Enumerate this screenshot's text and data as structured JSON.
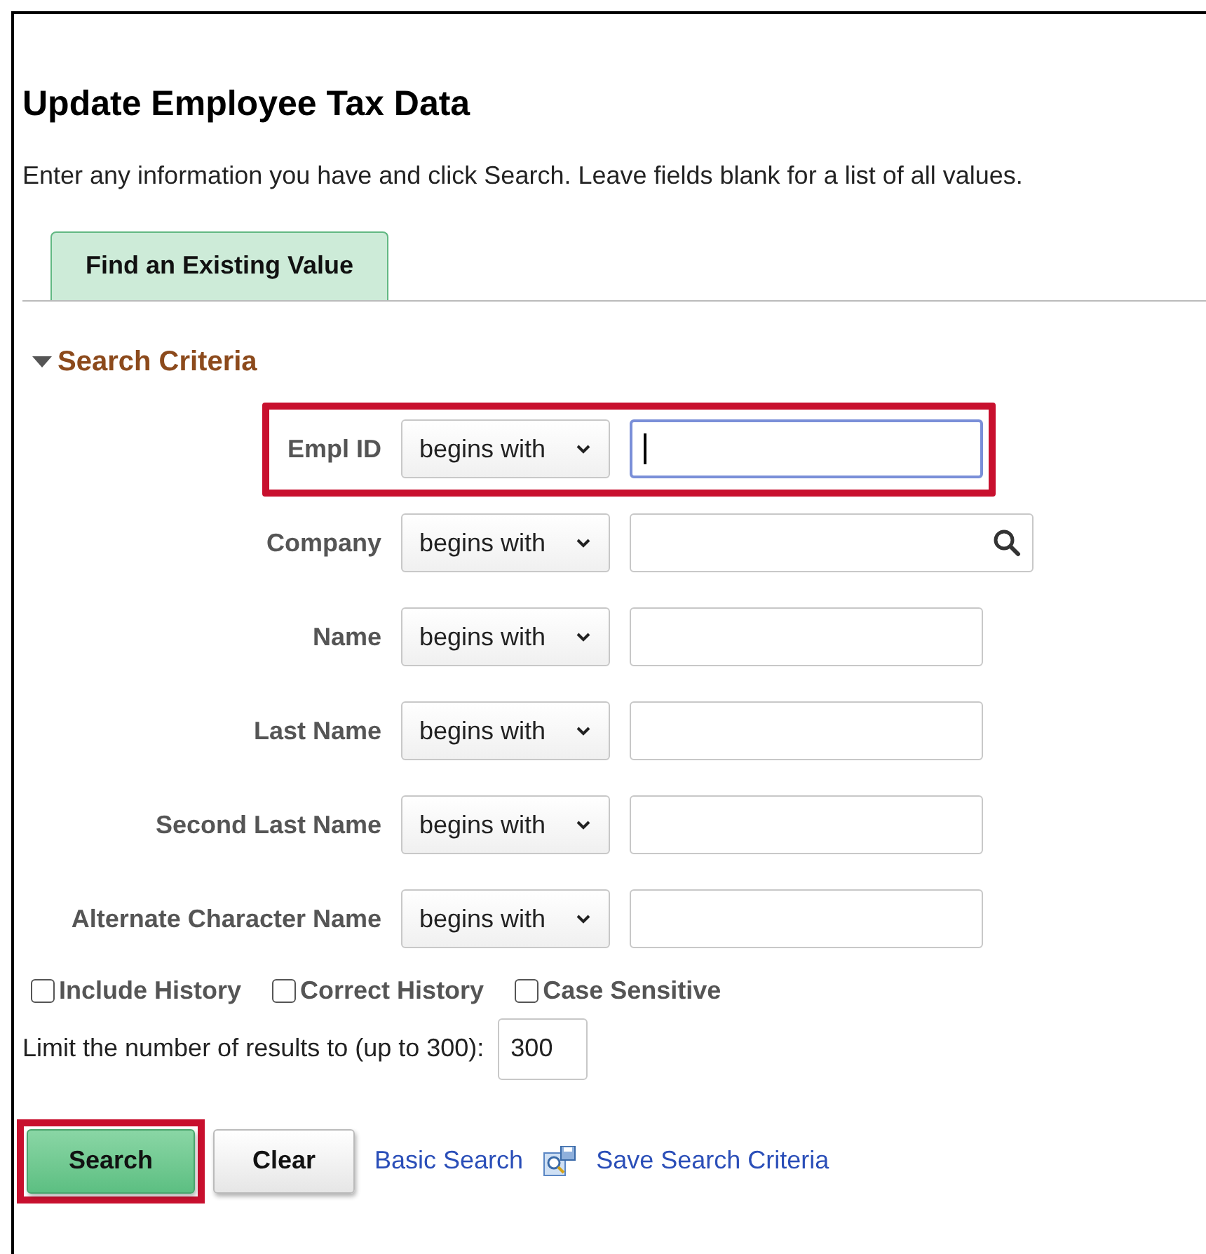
{
  "title": "Update Employee Tax Data",
  "instructions": "Enter any information you have and click Search. Leave fields blank for a list of all values.",
  "tabs": [
    {
      "label": "Find an Existing Value",
      "selected": true
    }
  ],
  "section": {
    "title": "Search Criteria",
    "expanded": true
  },
  "fields": [
    {
      "label": "Empl ID",
      "operator": "begins with",
      "kind": "text",
      "focused": true,
      "highlighted": true
    },
    {
      "label": "Company",
      "operator": "begins with",
      "kind": "lookup",
      "focused": false,
      "highlighted": false
    },
    {
      "label": "Name",
      "operator": "begins with",
      "kind": "text",
      "focused": false,
      "highlighted": false
    },
    {
      "label": "Last Name",
      "operator": "begins with",
      "kind": "text",
      "focused": false,
      "highlighted": false
    },
    {
      "label": "Second Last Name",
      "operator": "begins with",
      "kind": "text",
      "focused": false,
      "highlighted": false
    },
    {
      "label": "Alternate Character Name",
      "operator": "begins with",
      "kind": "text",
      "focused": false,
      "highlighted": false
    }
  ],
  "checkboxes": [
    {
      "label": "Include History",
      "checked": false
    },
    {
      "label": "Correct History",
      "checked": false
    },
    {
      "label": "Case Sensitive",
      "checked": false
    }
  ],
  "limit": {
    "label": "Limit the number of results to (up to 300):",
    "value": "300"
  },
  "buttons": [
    {
      "label": "Search",
      "kind": "primary",
      "highlighted": true
    },
    {
      "label": "Clear",
      "kind": "secondary",
      "highlighted": false
    }
  ],
  "links": [
    {
      "label": "Basic Search",
      "kind": "plain"
    },
    {
      "label": "Save Search Criteria",
      "kind": "save"
    }
  ]
}
